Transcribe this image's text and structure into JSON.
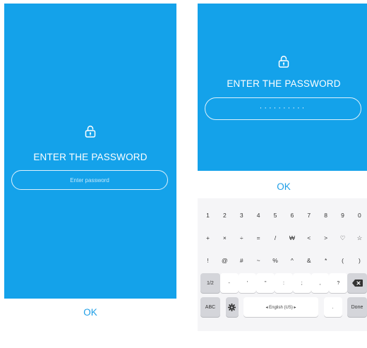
{
  "screen1": {
    "title": "ENTER THE PASSWORD",
    "password_placeholder": "Enter password",
    "ok_label": "OK"
  },
  "screen2": {
    "title": "ENTER THE PASSWORD",
    "password_dots": "··········",
    "ok_label": "OK",
    "keyboard": {
      "row1": [
        "1",
        "2",
        "3",
        "4",
        "5",
        "6",
        "7",
        "8",
        "9",
        "0"
      ],
      "row2": [
        "+",
        "×",
        "÷",
        "=",
        "/",
        "₩",
        "<",
        ">",
        "♡",
        "☆"
      ],
      "row3": [
        "!",
        "@",
        "#",
        "~",
        "%",
        "^",
        "&",
        "*",
        "(",
        ")"
      ],
      "row4": [
        "1/2",
        "-",
        "'",
        "\"",
        ":",
        ";",
        ",",
        "?"
      ],
      "bottom": {
        "abc_label": "ABC",
        "space_label": "◂ English (US) ▸",
        "period": ".",
        "done_label": "Done"
      }
    }
  },
  "colors": {
    "primary_blue": "#14a2ea",
    "ok_text": "#1d9ee6",
    "keyboard_bg": "#f5f5f7"
  },
  "icons": [
    "lock-icon",
    "gear-icon",
    "backspace-icon"
  ]
}
